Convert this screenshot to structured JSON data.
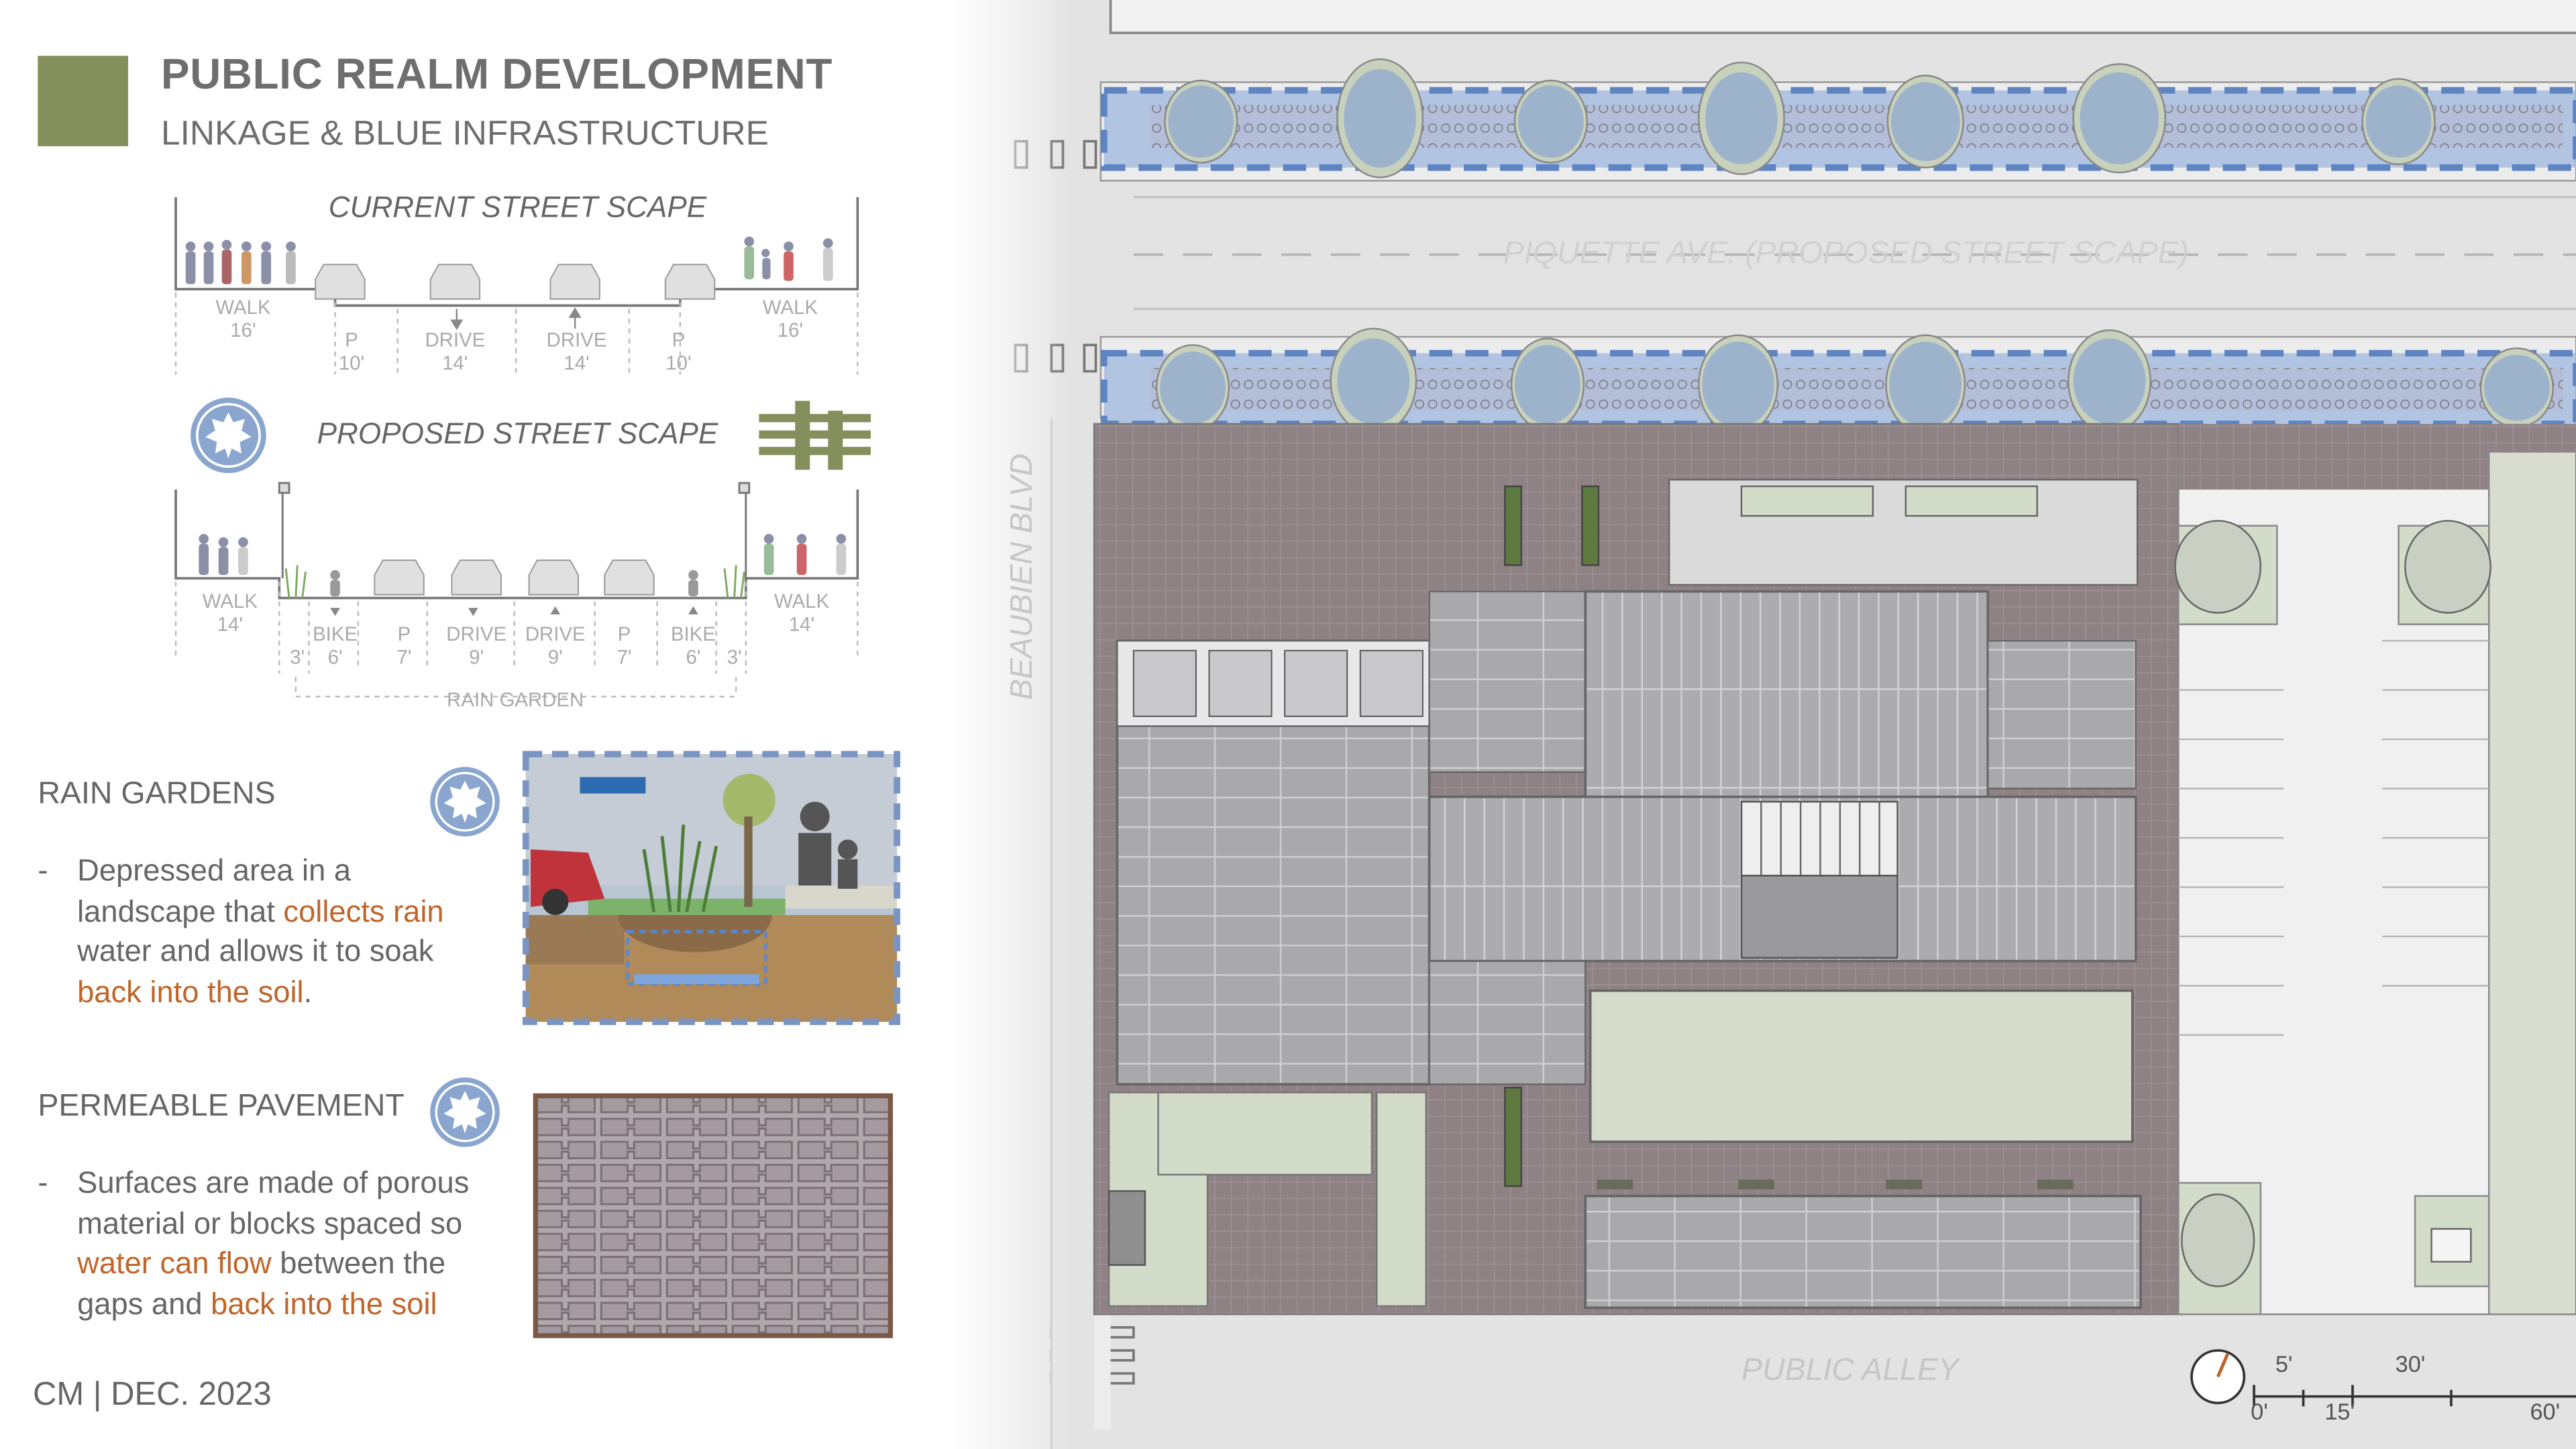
{
  "header": {
    "title": "PUBLIC REALM DEVELOPMENT",
    "subtitle": "LINKAGE & BLUE INFRASTRUCTURE",
    "accent_color": "#858f5c"
  },
  "current_section": {
    "title": "CURRENT STREET SCAPE",
    "lanes": [
      {
        "name": "WALK",
        "width": "16'"
      },
      {
        "name": "P",
        "width": "10'"
      },
      {
        "name": "DRIVE",
        "width": "14'"
      },
      {
        "name": "DRIVE",
        "width": "14'"
      },
      {
        "name": "P",
        "width": "10'"
      },
      {
        "name": "WALK",
        "width": "16'"
      }
    ]
  },
  "proposed_section": {
    "title": "PROPOSED STREET SCAPE",
    "lanes": [
      {
        "name": "WALK",
        "width": "14'"
      },
      {
        "name": "",
        "width": "3'"
      },
      {
        "name": "BIKE",
        "width": "6'"
      },
      {
        "name": "P",
        "width": "7'"
      },
      {
        "name": "DRIVE",
        "width": "9'"
      },
      {
        "name": "DRIVE",
        "width": "9'"
      },
      {
        "name": "P",
        "width": "7'"
      },
      {
        "name": "BIKE",
        "width": "6'"
      },
      {
        "name": "",
        "width": "3'"
      },
      {
        "name": "WALK",
        "width": "14'"
      }
    ],
    "rain_garden_label": "RAIN GARDEN"
  },
  "rain_gardens": {
    "heading": "RAIN GARDENS",
    "bullet": "-",
    "text_1": "Depressed area in a landscape that ",
    "highlight_1": "collects rain",
    "text_2": " water and allows it to soak ",
    "highlight_2": "back into the soil",
    "text_3": "."
  },
  "permeable": {
    "heading": "PERMEABLE PAVEMENT",
    "bullet": "-",
    "text_1": "Surfaces are made of porous material or blocks spaced so ",
    "highlight_1": "water can flow",
    "text_2": " between the gaps and ",
    "highlight_2": "back into the soil"
  },
  "footer": "CM | DEC. 2023",
  "plan": {
    "street_label": "PIQUETTE AVE. (PROPOSED STREET SCAPE)",
    "side_street_label": "BEAUBIEN BLVD",
    "alley_label": "PUBLIC ALLEY",
    "scale": [
      "5'",
      "30'",
      "0'",
      "15'",
      "60'"
    ]
  },
  "colors": {
    "highlight": "#c0652a",
    "blue_infra": "#7fa3d6",
    "paving": "#8f8285",
    "roof": "#a9a9ab",
    "lawn": "#d6dccb"
  }
}
